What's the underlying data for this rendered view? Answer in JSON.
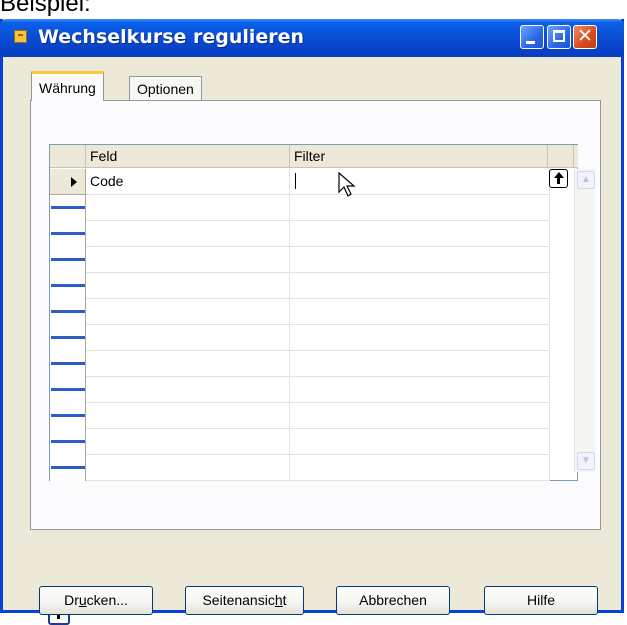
{
  "above_text": "Beispiel:",
  "window": {
    "title": "Wechselkurse regulieren"
  },
  "titlebar_buttons": {
    "minimize": "minimize-icon",
    "maximize": "maximize-icon",
    "close": "close-icon",
    "close_glyph": "✕"
  },
  "tabs": [
    {
      "label": "Währung",
      "active": true
    },
    {
      "label": "Optionen",
      "active": false
    }
  ],
  "grid": {
    "columns": [
      "Feld",
      "Filter"
    ],
    "rows": [
      {
        "feld": "Code",
        "filter": "",
        "current": true
      }
    ],
    "empty_rows": 11
  },
  "buttons": [
    {
      "label_before": "Dr",
      "mnemonic": "u",
      "label_after": "cken..."
    },
    {
      "label_before": "Seitenansic",
      "mnemonic": "h",
      "label_after": "t"
    },
    {
      "label_before": "Abbrechen",
      "mnemonic": "",
      "label_after": ""
    },
    {
      "label_before": "Hilfe",
      "mnemonic": "",
      "label_after": ""
    }
  ],
  "colors": {
    "titlebar": "#0a4fd6",
    "dialog_bg": "#ece9d8",
    "tab_highlight": "#ffc83c"
  }
}
